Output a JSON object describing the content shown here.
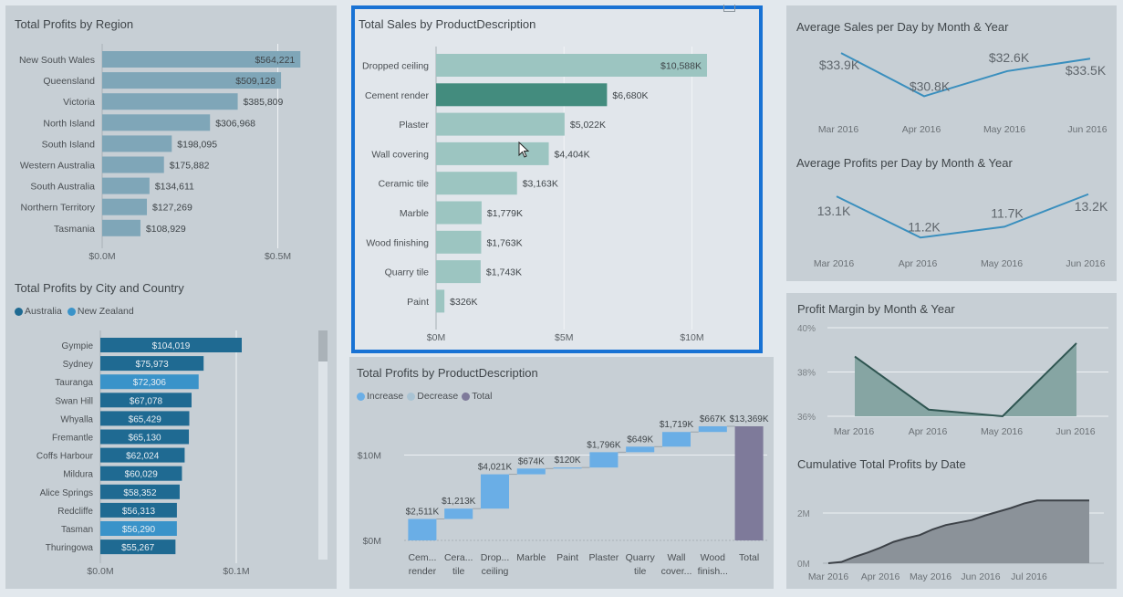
{
  "colors": {
    "background": "#e2e8ed",
    "panel": "#c7cfd5",
    "selected_border": "#1872d4",
    "region_bar": "#7fa6b8",
    "australia": "#1f6a92",
    "new_zealand": "#3a93c9",
    "sales_bar": "#9cc5c1",
    "sales_bar_highlight": "#438c7e",
    "increase": "#6aaee6",
    "decrease": "#a9c3d3",
    "total": "#7e7a9a",
    "line": "#3a8fbe",
    "margin_area": "#86a5a3",
    "margin_line": "#2f5551",
    "cumulative_area": "#8b9299",
    "cumulative_line": "#3d4248"
  },
  "chart_data": [
    {
      "id": "profits_by_region",
      "type": "bar",
      "orientation": "horizontal",
      "title": "Total Profits by Region",
      "categories": [
        "New South Wales",
        "Queensland",
        "Victoria",
        "North Island",
        "South Island",
        "Western Australia",
        "South Australia",
        "Northern Territory",
        "Tasmania"
      ],
      "values": [
        564221,
        509128,
        385809,
        306968,
        198095,
        175882,
        134611,
        127269,
        108929
      ],
      "data_labels": [
        "$564,221",
        "$509,128",
        "$385,809",
        "$306,968",
        "$198,095",
        "$175,882",
        "$134,611",
        "$127,269",
        "$108,929"
      ],
      "xticks": [
        "$0.0M",
        "$0.5M"
      ],
      "xtick_values": [
        0,
        500000
      ],
      "xlim": [
        0,
        620000
      ]
    },
    {
      "id": "profits_by_city",
      "type": "bar",
      "orientation": "horizontal",
      "title": "Total Profits by City and Country",
      "legend": [
        {
          "name": "Australia"
        },
        {
          "name": "New Zealand"
        }
      ],
      "categories": [
        "Gympie",
        "Sydney",
        "Tauranga",
        "Swan Hill",
        "Whyalla",
        "Fremantle",
        "Coffs Harbour",
        "Mildura",
        "Alice Springs",
        "Redcliffe",
        "Tasman",
        "Thuringowa"
      ],
      "values": [
        104019,
        75973,
        72306,
        67078,
        65429,
        65130,
        62024,
        60029,
        58352,
        56313,
        56290,
        55267
      ],
      "country": [
        "Australia",
        "Australia",
        "New Zealand",
        "Australia",
        "Australia",
        "Australia",
        "Australia",
        "Australia",
        "Australia",
        "Australia",
        "New Zealand",
        "Australia"
      ],
      "data_labels": [
        "$104,019",
        "$75,973",
        "$72,306",
        "$67,078",
        "$65,429",
        "$65,130",
        "$62,024",
        "$60,029",
        "$58,352",
        "$56,313",
        "$56,290",
        "$55,267"
      ],
      "xticks": [
        "$0.0M",
        "$0.1M"
      ],
      "xtick_values": [
        0,
        100000
      ],
      "xlim": [
        0,
        160000
      ]
    },
    {
      "id": "sales_by_product",
      "type": "bar",
      "orientation": "horizontal",
      "title": "Total Sales by ProductDescription",
      "selected": true,
      "highlighted_category": "Cement render",
      "categories": [
        "Dropped ceiling",
        "Cement render",
        "Plaster",
        "Wall covering",
        "Ceramic tile",
        "Marble",
        "Wood finishing",
        "Quarry tile",
        "Paint"
      ],
      "values": [
        10588,
        6680,
        5022,
        4404,
        3163,
        1779,
        1763,
        1743,
        326
      ],
      "unit": "$K",
      "data_labels": [
        "$10,588K",
        "$6,680K",
        "$5,022K",
        "$4,404K",
        "$3,163K",
        "$1,779K",
        "$1,763K",
        "$1,743K",
        "$326K"
      ],
      "xticks": [
        "$0M",
        "$5M",
        "$10M"
      ],
      "xtick_values": [
        0,
        5000,
        10000
      ],
      "xlim": [
        0,
        12000
      ]
    },
    {
      "id": "profits_by_product_waterfall",
      "type": "bar",
      "subtype": "waterfall",
      "title": "Total Profits by ProductDescription",
      "legend": [
        {
          "name": "Increase"
        },
        {
          "name": "Decrease"
        },
        {
          "name": "Total"
        }
      ],
      "categories": [
        "Cem... render",
        "Cera... tile",
        "Drop... ceiling",
        "Marble",
        "Paint",
        "Plaster",
        "Quarry tile",
        "Wall cover...",
        "Wood finish...",
        "Total"
      ],
      "category_lines": [
        [
          "Cem...",
          "render"
        ],
        [
          "Cera...",
          "tile"
        ],
        [
          "Drop...",
          "ceiling"
        ],
        [
          "Marble"
        ],
        [
          "Paint"
        ],
        [
          "Plaster"
        ],
        [
          "Quarry",
          "tile"
        ],
        [
          "Wall",
          "cover..."
        ],
        [
          "Wood",
          "finish..."
        ],
        [
          "Total"
        ]
      ],
      "values": [
        2511,
        1213,
        4021,
        674,
        120,
        1796,
        649,
        1719,
        667,
        13369
      ],
      "kind": [
        "increase",
        "increase",
        "increase",
        "increase",
        "increase",
        "increase",
        "increase",
        "increase",
        "increase",
        "total"
      ],
      "unit": "$K",
      "data_labels": [
        "$2,511K",
        "$1,213K",
        "$4,021K",
        "$674K",
        "$120K",
        "$1,796K",
        "$649K",
        "$1,719K",
        "$667K",
        "$13,369K"
      ],
      "yticks": [
        "$0M",
        "$10M"
      ],
      "ytick_values": [
        0,
        10000
      ],
      "ylim": [
        0,
        13900
      ]
    },
    {
      "id": "avg_sales_per_day",
      "type": "line",
      "title": "Average Sales per Day by Month & Year",
      "categories": [
        "Mar 2016",
        "Apr 2016",
        "May 2016",
        "Jun 2016"
      ],
      "values": [
        33.9,
        30.8,
        32.6,
        33.5
      ],
      "unit": "$K",
      "data_labels": [
        "$33.9K",
        "$30.8K",
        "$32.6K",
        "$33.5K"
      ],
      "ylim": [
        30.5,
        34.3
      ]
    },
    {
      "id": "avg_profits_per_day",
      "type": "line",
      "title": "Average Profits per Day by Month & Year",
      "categories": [
        "Mar 2016",
        "Apr 2016",
        "May 2016",
        "Jun 2016"
      ],
      "values": [
        13.1,
        11.2,
        11.7,
        13.2
      ],
      "unit": "K",
      "data_labels": [
        "13.1K",
        "11.2K",
        "11.7K",
        "13.2K"
      ],
      "ylim": [
        11.0,
        13.4
      ]
    },
    {
      "id": "profit_margin",
      "type": "area",
      "title": "Profit Margin by Month & Year",
      "categories": [
        "Mar 2016",
        "Apr 2016",
        "May 2016",
        "Jun 2016"
      ],
      "values": [
        38.7,
        36.3,
        36.0,
        39.3
      ],
      "unit": "%",
      "yticks": [
        "36%",
        "38%",
        "40%"
      ],
      "ytick_values": [
        36,
        38,
        40
      ],
      "ylim": [
        36,
        40
      ]
    },
    {
      "id": "cumulative_profits",
      "type": "area",
      "title": "Cumulative Total Profits by Date",
      "xticks": [
        "Mar 2016",
        "Apr 2016",
        "May 2016",
        "Jun 2016",
        "Jul 2016"
      ],
      "yticks": [
        "0M",
        "2M"
      ],
      "ytick_values": [
        0,
        2
      ],
      "ylim": [
        0,
        2.8
      ],
      "x": [
        0,
        0.05,
        0.1,
        0.15,
        0.2,
        0.25,
        0.3,
        0.35,
        0.4,
        0.45,
        0.5,
        0.55,
        0.6,
        0.65,
        0.7,
        0.75,
        0.8,
        0.85,
        0.9,
        0.95,
        1.0
      ],
      "values": [
        0.0,
        0.05,
        0.25,
        0.42,
        0.62,
        0.85,
        1.0,
        1.12,
        1.35,
        1.52,
        1.62,
        1.72,
        1.9,
        2.05,
        2.2,
        2.38,
        2.5,
        2.5,
        2.5,
        2.5,
        2.5
      ]
    }
  ]
}
